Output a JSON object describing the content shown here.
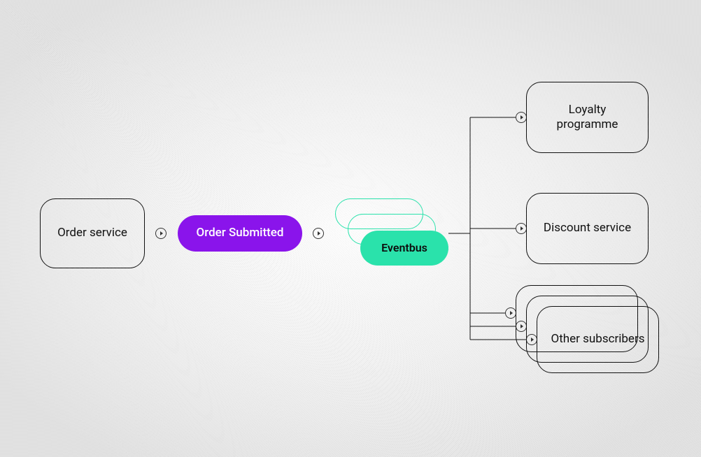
{
  "nodes": {
    "order_service": "Order service",
    "order_submitted": "Order Submitted",
    "eventbus": "Eventbus",
    "subscribers": {
      "loyalty": "Loyalty programme",
      "discount": "Discount service",
      "other": "Other subscribers"
    }
  },
  "colors": {
    "accent_purple": "#8a14eb",
    "accent_mint": "#2ae2ab",
    "stroke": "#111111"
  }
}
